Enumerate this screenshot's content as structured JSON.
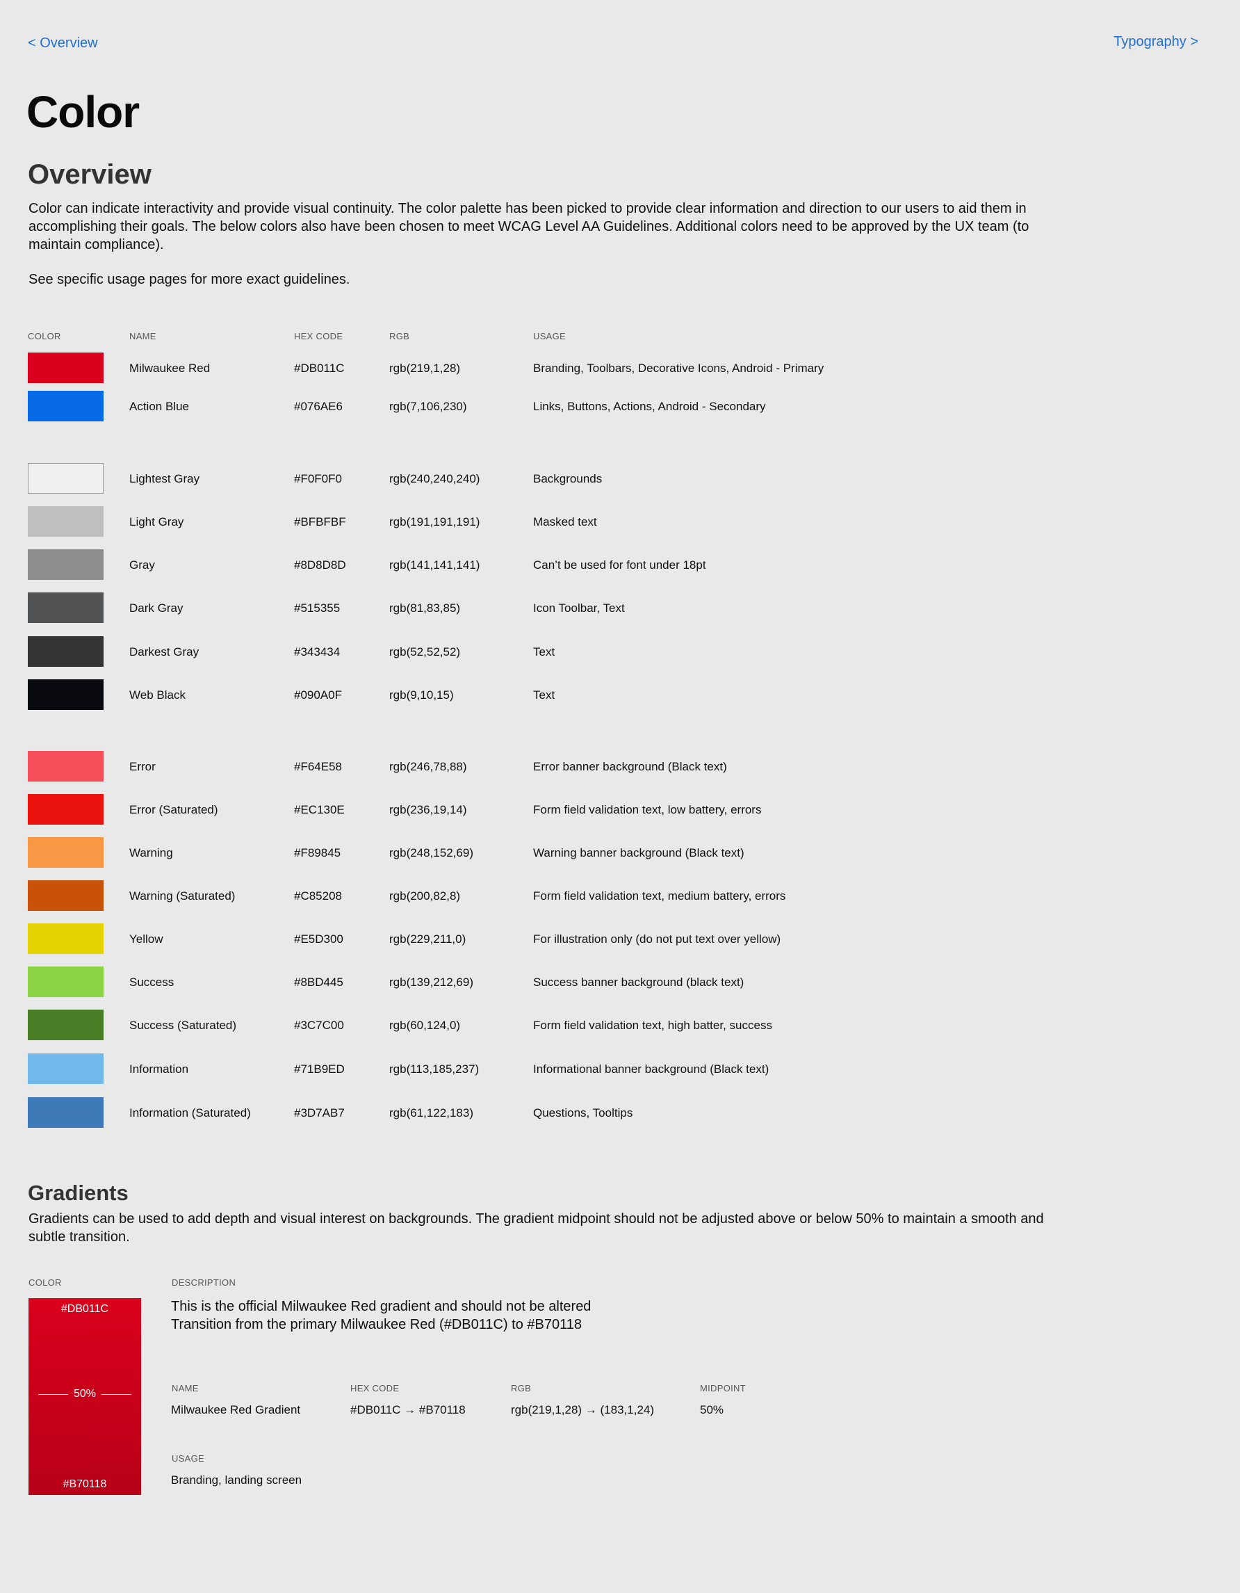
{
  "nav": {
    "prev": "< Overview",
    "next": "Typography >"
  },
  "page_title": "Color",
  "overview": {
    "heading": "Overview",
    "body": "Color can indicate interactivity and provide visual continuity. The color palette has been picked to provide clear information and direction to our users to aid them in accomplishing their goals. The below colors also have been chosen to meet WCAG Level AA Guidelines. Additional colors need to be approved by the UX team (to maintain compliance).",
    "note": "See specific usage pages for more exact guidelines."
  },
  "table": {
    "headers": {
      "color": "COLOR",
      "name": "NAME",
      "hex": "HEX CODE",
      "rgb": "RGB",
      "usage": "USAGE"
    },
    "rows": [
      {
        "name": "Milwaukee Red",
        "hex": "#DB011C",
        "rgb": "rgb(219,1,28)",
        "usage": "Branding, Toolbars, Decorative Icons, Android - Primary",
        "swatch": "#DB011C"
      },
      {
        "name": "Action Blue",
        "hex": "#076AE6",
        "rgb": "rgb(7,106,230)",
        "usage": "Links, Buttons, Actions, Android - Secondary",
        "swatch": "#076AE6"
      },
      {
        "name": "Lightest Gray",
        "hex": "#F0F0F0",
        "rgb": "rgb(240,240,240)",
        "usage": "Backgrounds",
        "swatch": "#F0F0F0"
      },
      {
        "name": "Light Gray",
        "hex": "#BFBFBF",
        "rgb": "rgb(191,191,191)",
        "usage": "Masked text",
        "swatch": "#BFBFBF"
      },
      {
        "name": "Gray",
        "hex": "#8D8D8D",
        "rgb": "rgb(141,141,141)",
        "usage": "Can’t be used for font under 18pt",
        "swatch": "#8D8D8D"
      },
      {
        "name": "Dark Gray",
        "hex": "#515355",
        "rgb": "rgb(81,83,85)",
        "usage": "Icon Toolbar, Text",
        "swatch": "#515355"
      },
      {
        "name": "Darkest Gray",
        "hex": "#343434",
        "rgb": "rgb(52,52,52)",
        "usage": "Text",
        "swatch": "#343434"
      },
      {
        "name": "Web Black",
        "hex": "#090A0F",
        "rgb": "rgb(9,10,15)",
        "usage": "Text",
        "swatch": "#090A0F"
      },
      {
        "name": "Error",
        "hex": "#F64E58",
        "rgb": "rgb(246,78,88)",
        "usage": "Error banner background (Black text)",
        "swatch": "#F64E58"
      },
      {
        "name": "Error (Saturated)",
        "hex": "#EC130E",
        "rgb": "rgb(236,19,14)",
        "usage": "Form field validation text, low battery, errors",
        "swatch": "#EC130E"
      },
      {
        "name": "Warning",
        "hex": "#F89845",
        "rgb": "rgb(248,152,69)",
        "usage": "Warning banner background (Black text)",
        "swatch": "#F89845"
      },
      {
        "name": "Warning (Saturated)",
        "hex": "#C85208",
        "rgb": "rgb(200,82,8)",
        "usage": "Form field validation text, medium battery, errors",
        "swatch": "#C85208"
      },
      {
        "name": "Yellow",
        "hex": "#E5D300",
        "rgb": "rgb(229,211,0)",
        "usage": "For illustration only (do not put text over yellow)",
        "swatch": "#E5D300"
      },
      {
        "name": "Success",
        "hex": "#8BD445",
        "rgb": "rgb(139,212,69)",
        "usage": "Success banner background (black text)",
        "swatch": "#8BD445"
      },
      {
        "name": "Success (Saturated)",
        "hex": "#3C7C00",
        "rgb": "rgb(60,124,0)",
        "usage": "Form field validation text, high batter, success",
        "swatch": "#4A7F28"
      },
      {
        "name": "Information",
        "hex": "#71B9ED",
        "rgb": "rgb(113,185,237)",
        "usage": "Informational banner background (Black text)",
        "swatch": "#71B9ED"
      },
      {
        "name": "Information (Saturated)",
        "hex": "#3D7AB7",
        "rgb": "rgb(61,122,183)",
        "usage": "Questions, Tooltips",
        "swatch": "#3D7AB7"
      }
    ]
  },
  "gradients": {
    "heading": "Gradients",
    "body": "Gradients can be used to add depth and visual interest on backgrounds. The gradient midpoint should not be adjusted above or below 50% to maintain a smooth and subtle transition.",
    "labels": {
      "color": "COLOR",
      "description": "DESCRIPTION",
      "name": "NAME",
      "hex": "HEX CODE",
      "rgb": "RGB",
      "midpoint": "MIDPOINT",
      "usage": "USAGE"
    },
    "item": {
      "swatch_top": "#DB011C",
      "swatch_mid": "50%",
      "swatch_bottom": "#B70118",
      "desc_line1": "This is the official Milwaukee Red gradient and should not be altered",
      "desc_line2": "Transition from the primary Milwaukee Red (#DB011C) to #B70118",
      "name": "Milwaukee Red Gradient",
      "hex": "#DB011C → #B70118",
      "rgb": "rgb(219,1,28) → (183,1,24)",
      "midpoint": "50%",
      "usage": "Branding, landing screen"
    }
  }
}
